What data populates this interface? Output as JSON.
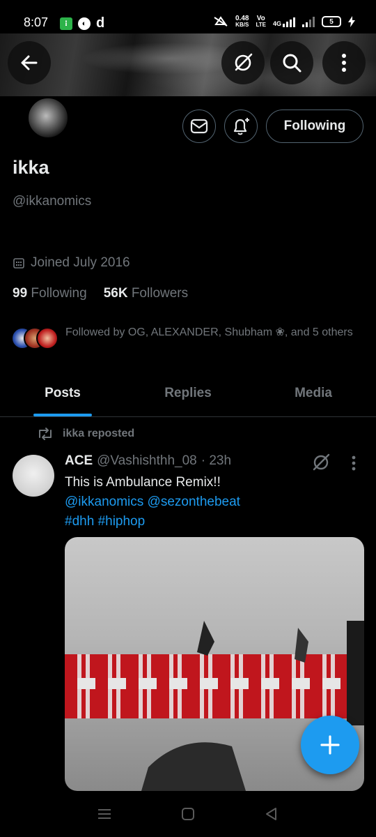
{
  "status_bar": {
    "time": "8:07",
    "speed_value": "0.48",
    "speed_unit": "KB/S",
    "volte_top": "Vo",
    "volte_bottom": "LTE",
    "network": "4G",
    "battery": "5"
  },
  "header": {
    "back_icon": "arrow-left-icon",
    "grok_icon": "grok-icon",
    "search_icon": "search-icon",
    "more_icon": "more-vertical-icon"
  },
  "profile": {
    "display_name": "ikka",
    "handle": "@ikkanomics",
    "joined": "Joined July 2016",
    "following_count": "99",
    "following_label": "Following",
    "followers_count": "56K",
    "followers_label": "Followers",
    "followed_by": "Followed by OG, ALEXANDER, Shubham ❀, and 5 others",
    "follow_button_label": "Following"
  },
  "tabs": [
    {
      "label": "Posts",
      "active": true
    },
    {
      "label": "Replies",
      "active": false
    },
    {
      "label": "Media",
      "active": false
    }
  ],
  "post": {
    "repost_label": "ikka reposted",
    "author_name": "ACE",
    "author_handle": "@Vashishthh_08",
    "time": "· 23h",
    "text_line1": "This is Ambulance Remix!!",
    "mention1": "@ikkanomics",
    "mention2": "@sezonthebeat",
    "hashtag1": "#dhh",
    "hashtag2": "#hiphop"
  },
  "colors": {
    "accent": "#1d9bf0",
    "muted": "#71767b",
    "border": "#536471",
    "media_red": "#c0161d"
  }
}
